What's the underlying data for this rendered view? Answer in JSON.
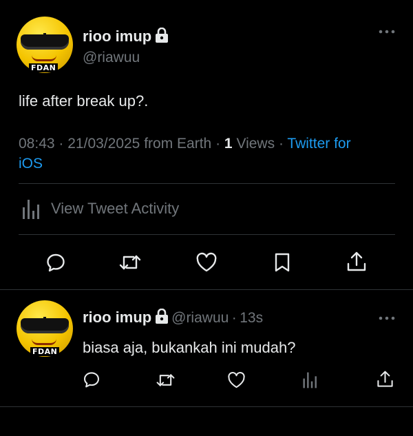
{
  "tweet": {
    "display_name": "rioo imup",
    "handle": "@riawuu",
    "avatar_badge": "FDAN",
    "text": "life after break up?.",
    "time": "08:43",
    "date": "21/03/2025",
    "location": "from Earth",
    "views_count": "1",
    "views_label": "Views",
    "client_line1": "Twitter for",
    "client_line2": "iOS",
    "activity_label": "View Tweet Activity",
    "sep": "·"
  },
  "reply": {
    "display_name": "rioo imup",
    "handle": "@riawuu",
    "time_ago": "13s",
    "avatar_badge": "FDAN",
    "text": "biasa aja, bukankah ini mudah?",
    "sep": "·"
  },
  "colors": {
    "background": "#000000",
    "text": "#e7e9ea",
    "muted": "#71767b",
    "link": "#1d9bf0",
    "divider": "#2f3336"
  },
  "icons": [
    "lock-icon",
    "more-icon",
    "analytics-icon",
    "reply-icon",
    "retweet-icon",
    "like-icon",
    "bookmark-icon",
    "share-icon"
  ]
}
